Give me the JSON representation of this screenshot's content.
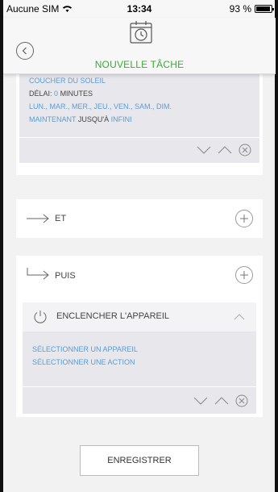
{
  "status_bar": {
    "carrier": "Aucune SIM",
    "time": "13:34",
    "battery": "93 %"
  },
  "header": {
    "title": "NOUVELLE TÂCHE",
    "back_icon": "chevron-left-icon",
    "task_icon": "calendar-clock-icon"
  },
  "condition": {
    "event": "COUCHER DU SOLEIL",
    "delay_label": "DÉLAI:",
    "delay_value": "0",
    "delay_unit": "MINUTES",
    "days": "LUN., MAR., MER., JEU., VEN., SAM., DIM.",
    "range_start": "MAINTENANT",
    "range_sep": "JUSQU'À",
    "range_end": "INFINI"
  },
  "and_row": {
    "label": "ET"
  },
  "then_row": {
    "label": "PUIS"
  },
  "action": {
    "title": "ENCLENCHER L'APPAREIL",
    "select_device": "SÉLECTIONNER UN APPAREIL",
    "select_action": "SÉLECTIONNER UNE ACTION"
  },
  "footer": {
    "save_label": "ENREGISTRER"
  },
  "colors": {
    "accent_green": "#3aaa35",
    "link_blue": "#5b9bd5"
  }
}
